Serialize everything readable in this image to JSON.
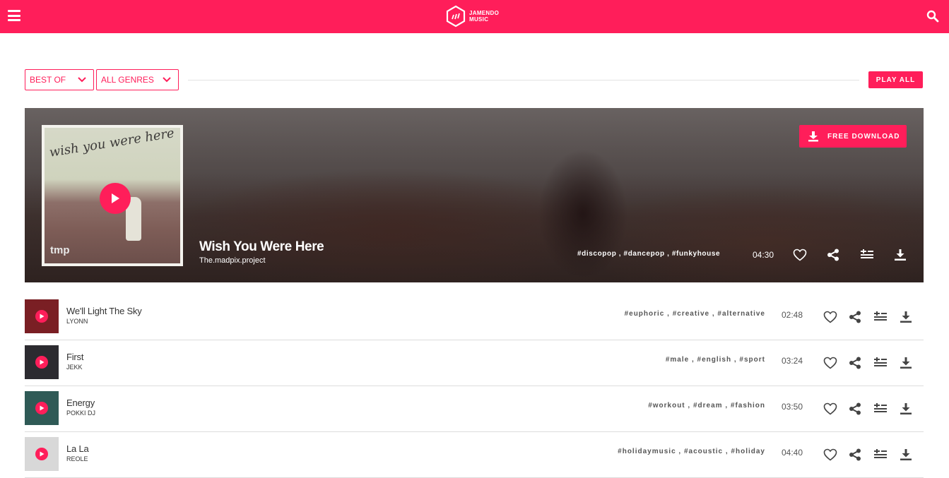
{
  "header": {
    "logo_line1": "JAMENDO",
    "logo_line2": "MUSIC",
    "brand_color": "#ff1e5a",
    "menu_icon": "hamburger-menu-icon",
    "search_icon": "search-icon"
  },
  "filters": {
    "sort": "BEST OF",
    "genre": "ALL GENRES",
    "play_all": "PLAY ALL"
  },
  "featured": {
    "title": "Wish You Were Here",
    "artist": "The.madpix.project",
    "tags": "#discopop , #dancepop , #funkyhouse",
    "duration": "04:30",
    "download_label": "FREE DOWNLOAD",
    "cover_text": "wish you were here",
    "cover_brand": "tmp"
  },
  "tracks": [
    {
      "title": "We'll Light The Sky",
      "artist": "LYONN",
      "tags": "#euphoric , #creative , #alternative",
      "duration": "02:48",
      "thumb_color": "#7a1f24"
    },
    {
      "title": "First",
      "artist": "JEKK",
      "tags": "#male , #english , #sport",
      "duration": "03:24",
      "thumb_color": "#2c2b30"
    },
    {
      "title": "Energy",
      "artist": "POKKI DJ",
      "tags": "#workout , #dream , #fashion",
      "duration": "03:50",
      "thumb_color": "#2f5a56"
    },
    {
      "title": "La La",
      "artist": "REOLE",
      "tags": "#holidaymusic , #acoustic , #holiday",
      "duration": "04:40",
      "thumb_color": "#d8d8d8"
    }
  ]
}
